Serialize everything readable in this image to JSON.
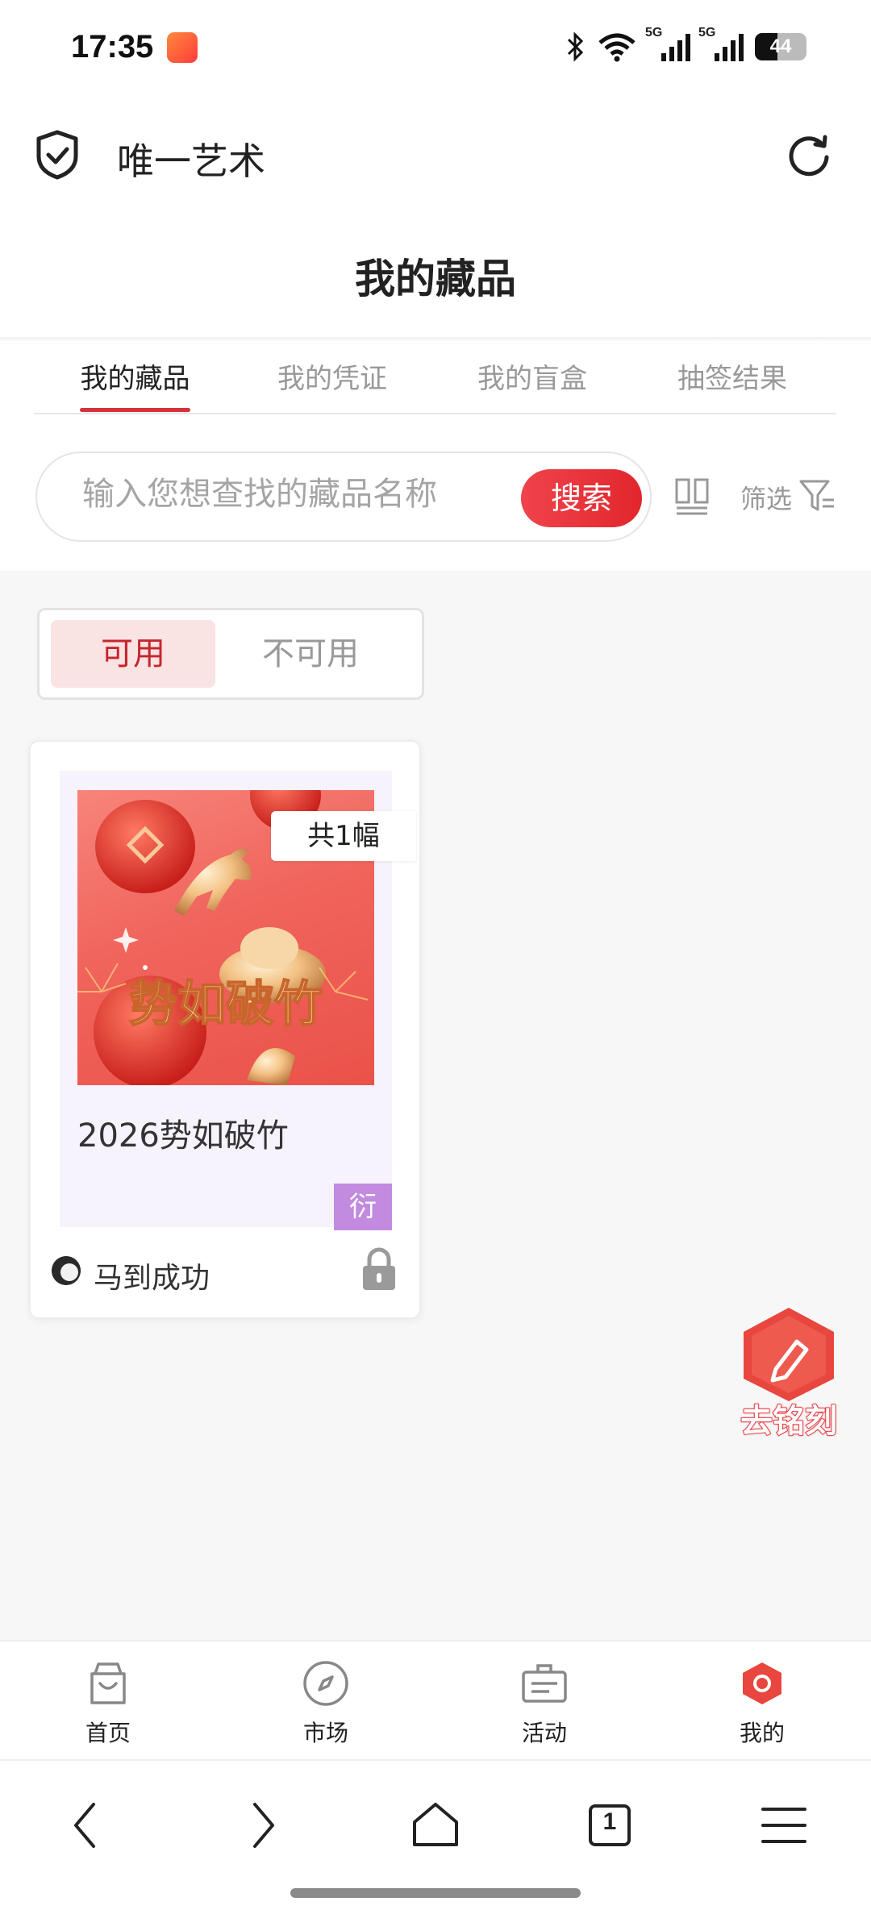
{
  "status_bar": {
    "time": "17:35",
    "network_1": "5G",
    "network_2": "5G",
    "battery": "44"
  },
  "header": {
    "app_name": "唯一艺术",
    "page_title": "我的藏品"
  },
  "tabs": [
    {
      "label": "我的藏品",
      "active": true
    },
    {
      "label": "我的凭证",
      "active": false
    },
    {
      "label": "我的盲盒",
      "active": false
    },
    {
      "label": "抽签结果",
      "active": false
    }
  ],
  "search": {
    "placeholder": "输入您想查找的藏品名称",
    "button": "搜索",
    "filter_label": "筛选"
  },
  "availability": {
    "available": "可用",
    "unavailable": "不可用"
  },
  "collection": [
    {
      "count": "共1幅",
      "image_text": "势如破竹",
      "title": "2026势如破竹",
      "tag": "衍",
      "author": "马到成功"
    }
  ],
  "floating": {
    "engrave_label": "去铭刻"
  },
  "bottom_nav": [
    {
      "label": "首页",
      "icon": "bag-icon"
    },
    {
      "label": "市场",
      "icon": "compass-icon"
    },
    {
      "label": "活动",
      "icon": "briefcase-icon"
    },
    {
      "label": "我的",
      "icon": "hexagon-icon",
      "active": true
    }
  ],
  "browser": {
    "tab_count": "1"
  },
  "colors": {
    "accent": "#e2262d",
    "accent_light": "#fae3e3",
    "tag": "#c28be0",
    "background": "#f7f7f8"
  }
}
